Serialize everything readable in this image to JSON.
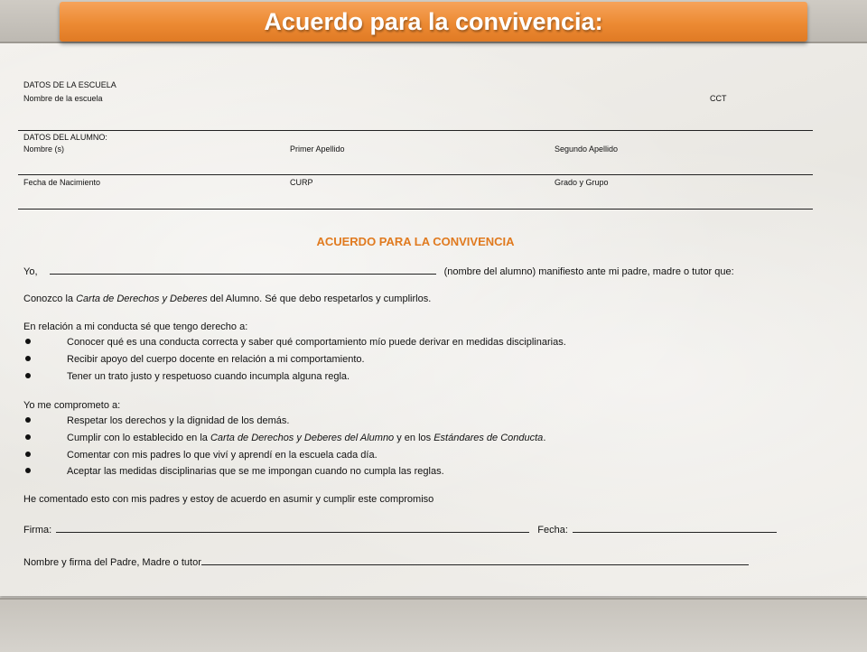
{
  "title": "Acuerdo para la convivencia:",
  "school": {
    "section_label": "DATOS DE LA ESCUELA",
    "name_label": "Nombre de la escuela",
    "cct_label": "CCT"
  },
  "student": {
    "section_label": "DATOS DEL ALUMNO:",
    "name_label": "Nombre (s)",
    "first_surname_label": "Primer Apellido",
    "second_surname_label": "Segundo Apellido",
    "birthdate_label": "Fecha de Nacimiento",
    "curp_label": "CURP",
    "grade_label": "Grado y Grupo"
  },
  "agreement": {
    "heading": "ACUERDO PARA LA CONVIVENCIA",
    "yo_prefix": "Yo,",
    "yo_suffix": "(nombre del alumno) manifiesto ante mi padre, madre o tutor que:",
    "conozco_a": "Conozco la ",
    "conozco_b": "Carta de Derechos y Deberes",
    "conozco_c": " del Alumno. Sé que debo respetarlos y cumplirlos.",
    "rights_intro": "En relación a mi conducta  sé que tengo derecho a:",
    "rights": [
      "Conocer qué es una conducta correcta y saber qué comportamiento mío puede derivar en medidas disciplinarias.",
      "Recibir apoyo del cuerpo docente en relación a mi comportamiento.",
      "Tener un trato justo y respetuoso cuando incumpla alguna regla."
    ],
    "commit_intro": "Yo me comprometo a:",
    "commit_1": "Respetar los derechos y la dignidad de los demás.",
    "commit_2_a": "Cumplir con lo establecido en la ",
    "commit_2_b": "Carta de Derechos y Deberes del Alumno",
    "commit_2_c": " y en los ",
    "commit_2_d": "Estándares de Conducta",
    "commit_2_e": ".",
    "commit_3": "Comentar con mis padres lo que viví y aprendí en la escuela cada día.",
    "commit_4": "Aceptar las medidas disciplinarias que se me impongan cuando no cumpla las reglas.",
    "closing": "He comentado esto con mis padres y estoy de acuerdo en asumir y cumplir este compromiso",
    "signature_label": "Firma:",
    "date_label": "Fecha:",
    "parent_label": "Nombre y firma del Padre, Madre o tutor"
  },
  "colors": {
    "banner": "#ec8a33",
    "heading": "#e07a1f"
  }
}
